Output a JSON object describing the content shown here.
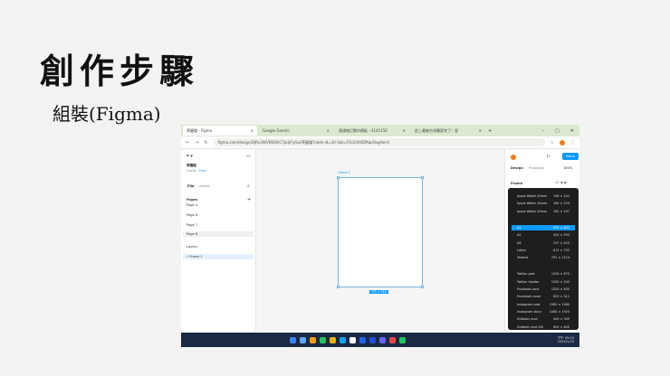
{
  "slide": {
    "title": "創作步驟",
    "subtitle": "組裝(Figma)"
  },
  "browser": {
    "tabs": [
      {
        "label": "草圖檔 - Figma",
        "active": true
      },
      {
        "label": "Google Gemini"
      },
      {
        "label": "連連線訂閱木模板 - 4141150"
      },
      {
        "label": "此上最被台灣畫家完了！皇"
      }
    ],
    "new_tab": "+",
    "window_controls": [
      "–",
      "▢",
      "✕"
    ],
    "url": "figma.com/design/DJRn3WVEN30iCTpUjFlySw/草圖檔?node-id=30-3&t=FOo1XHlDMqcElsgHw-0"
  },
  "figma": {
    "file_name": "草圖檔",
    "plan": "Drafts",
    "badge": "Free",
    "left_tabs": [
      "File",
      "Assets"
    ],
    "pages_label": "Pages",
    "pages": [
      "Page 4",
      "Page 6",
      "Page 7",
      "Page 8"
    ],
    "layers_label": "Layers",
    "layers": [
      "Frame 1"
    ],
    "frame_label": "Frame 1",
    "frame_size": "375 × 564",
    "share": "Share",
    "design_tab": "Design",
    "prototype_tab": "Prototype",
    "zoom": "180%",
    "frame_select": "Frame",
    "presets_group1": [
      {
        "name": "Apple Watch 45mm",
        "size": "198 × 242"
      },
      {
        "name": "Apple Watch 44mm",
        "size": "184 × 224"
      },
      {
        "name": "Apple Watch 40mm",
        "size": "162 × 197"
      }
    ],
    "presets_group2": [
      {
        "name": "A4",
        "size": "595 × 842",
        "selected": true
      },
      {
        "name": "A5",
        "size": "420 × 595"
      },
      {
        "name": "A6",
        "size": "297 × 420"
      },
      {
        "name": "Letter",
        "size": "612 × 792"
      },
      {
        "name": "Tabloid",
        "size": "792 × 1224"
      }
    ],
    "presets_group3": [
      {
        "name": "Twitter post",
        "size": "1200 × 675"
      },
      {
        "name": "Twitter header",
        "size": "1500 × 500"
      },
      {
        "name": "Facebook post",
        "size": "1200 × 630"
      },
      {
        "name": "Facebook cover",
        "size": "820 × 312"
      },
      {
        "name": "Instagram post",
        "size": "1080 × 1080"
      },
      {
        "name": "Instagram story",
        "size": "1080 × 1920"
      },
      {
        "name": "Dribbble shot",
        "size": "400 × 300"
      },
      {
        "name": "Dribbble shot HD",
        "size": "800 × 600"
      }
    ]
  },
  "taskbar": {
    "time": "下午 05:15",
    "date": "2025/1/15",
    "colors": [
      "#3b82f6",
      "#60a5fa",
      "#f59e0b",
      "#22c55e",
      "#eab308",
      "#0ea5e9",
      "#fff",
      "#2563eb",
      "#1d4ed8",
      "#6366f1",
      "#ef4444",
      "#22c55e"
    ]
  }
}
